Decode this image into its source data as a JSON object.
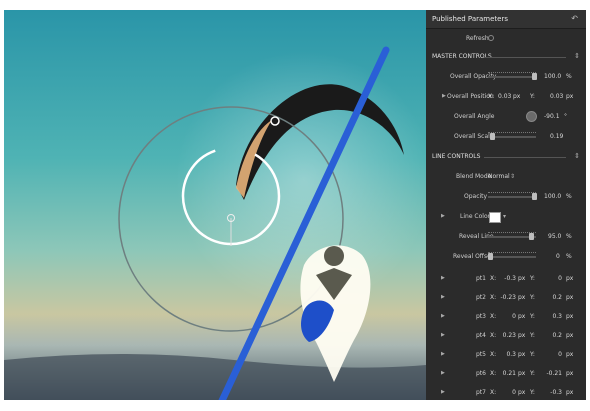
{
  "panel": {
    "title": "Published Parameters",
    "refresh_label": "Refresh",
    "master_controls": "MASTER CONTROLS",
    "overall_opacity": {
      "label": "Overall Opacity",
      "value": "100.0",
      "unit": "%",
      "level": 1.0
    },
    "overall_position": {
      "label": "Overall Position",
      "x_label": "X:",
      "x": "0.03",
      "x_unit": "px",
      "y_label": "Y:",
      "y": "0.03",
      "y_unit": "px"
    },
    "overall_angle": {
      "label": "Overall Angle",
      "value": "-90.1",
      "unit": "°"
    },
    "overall_scale": {
      "label": "Overall Scale",
      "value": "0.19",
      "level": 0.05
    },
    "line_controls": "LINE CONTROLS",
    "blend_mode": {
      "label": "Blend Mode",
      "value": "Normal"
    },
    "opacity": {
      "label": "Opacity",
      "value": "100.0",
      "unit": "%",
      "level": 1.0
    },
    "line_color": {
      "label": "Line Color",
      "color": "#ffffff"
    },
    "reveal_line": {
      "label": "Reveal Line",
      "value": "95.0",
      "unit": "%",
      "level": 0.95
    },
    "reveal_offset": {
      "label": "Reveal Offset",
      "value": "0",
      "unit": "%",
      "level": 0.0
    },
    "points": [
      {
        "label": "pt1",
        "x": "-0.3",
        "x_unit": "px",
        "y": "0",
        "y_unit": "px"
      },
      {
        "label": "pt2",
        "x": "-0.23",
        "x_unit": "px",
        "y": "0.2",
        "y_unit": "px"
      },
      {
        "label": "pt3",
        "x": "0",
        "x_unit": "px",
        "y": "0.3",
        "y_unit": "px"
      },
      {
        "label": "pt4",
        "x": "0.23",
        "x_unit": "px",
        "y": "0.2",
        "y_unit": "px"
      },
      {
        "label": "pt5",
        "x": "0.3",
        "x_unit": "px",
        "y": "0",
        "y_unit": "px"
      },
      {
        "label": "pt6",
        "x": "0.21",
        "x_unit": "px",
        "y": "-0.21",
        "y_unit": "px"
      },
      {
        "label": "pt7",
        "x": "0",
        "x_unit": "px",
        "y": "-0.3",
        "y_unit": "px"
      }
    ],
    "x_label": "X:",
    "y_label": "Y:"
  },
  "colors": {
    "panel_bg": "#2b2b2b",
    "accent_line": "#2a5fd6",
    "paraglider": "#1a1a1a"
  }
}
